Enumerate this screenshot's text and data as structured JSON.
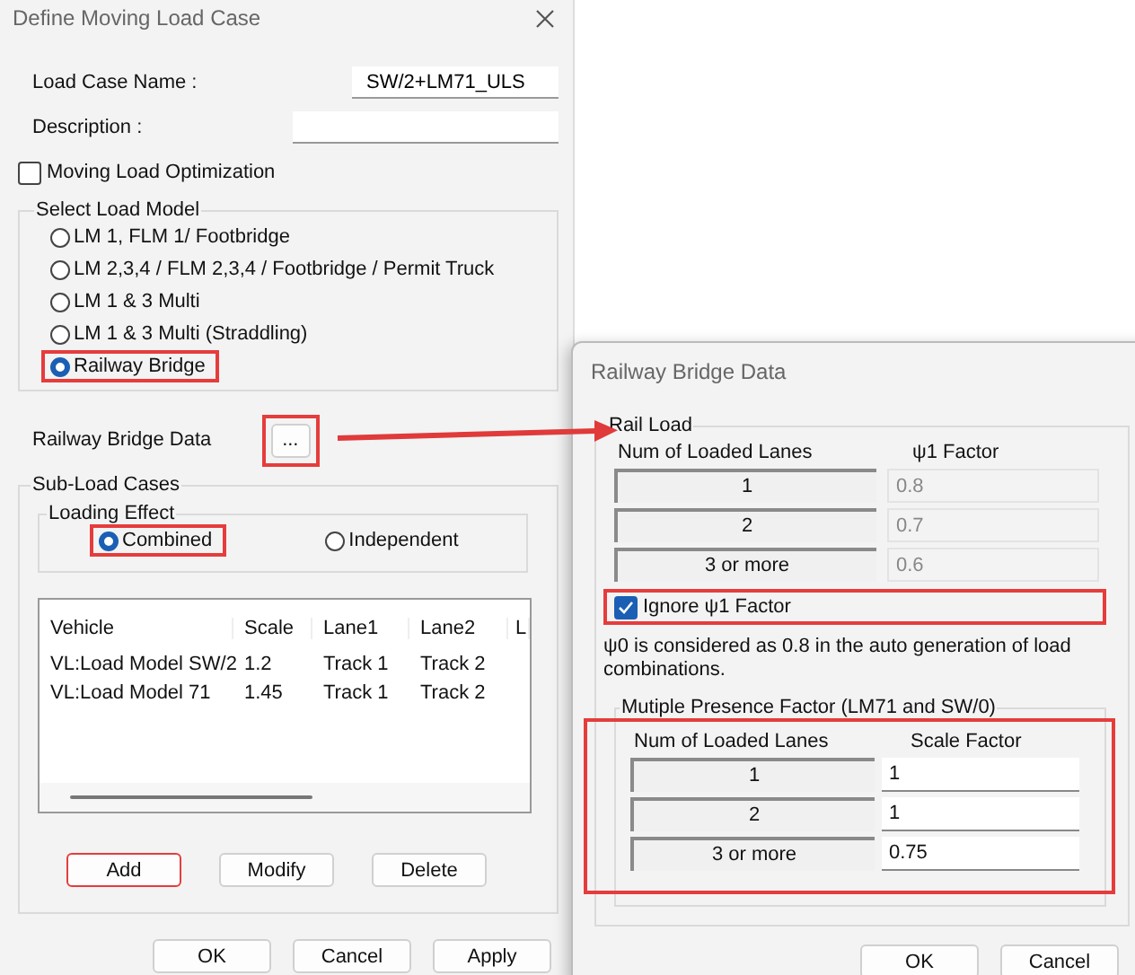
{
  "main_dialog": {
    "title": "Define Moving Load Case",
    "load_case_name": {
      "label": "Load Case Name  :",
      "value": "SW/2+LM71_ULS"
    },
    "description": {
      "label": "Description :"
    },
    "optimization": {
      "label": "Moving Load Optimization",
      "checked": false
    },
    "load_model": {
      "title": "Select Load Model",
      "options": [
        {
          "label": "LM 1, FLM 1/ Footbridge",
          "selected": false,
          "highlighted": false
        },
        {
          "label": "LM 2,3,4 / FLM 2,3,4 / Footbridge / Permit Truck",
          "selected": false,
          "highlighted": false
        },
        {
          "label": "LM 1 & 3 Multi",
          "selected": false,
          "highlighted": false
        },
        {
          "label": "LM 1 & 3 Multi (Straddling)",
          "selected": false,
          "highlighted": false
        },
        {
          "label": "Railway Bridge",
          "selected": true,
          "highlighted": true
        }
      ]
    },
    "railway_bridge_data": {
      "label": "Railway Bridge Data",
      "button": "...",
      "highlighted": true
    },
    "sub_load_cases": {
      "title": "Sub-Load Cases",
      "loading_effect": {
        "title": "Loading Effect",
        "options": [
          {
            "label": "Combined",
            "selected": true,
            "highlighted": true
          },
          {
            "label": "Independent",
            "selected": false,
            "highlighted": false
          }
        ]
      },
      "table": {
        "columns": [
          "Vehicle",
          "Scale",
          "Lane1",
          "Lane2",
          "L"
        ],
        "rows": [
          [
            "VL:Load Model SW/2",
            "1.2",
            "Track 1",
            "Track 2"
          ],
          [
            "VL:Load Model 71",
            "1.45",
            "Track 1",
            "Track 2"
          ]
        ]
      },
      "buttons": [
        {
          "label": "Add",
          "highlighted": true
        },
        {
          "label": "Modify",
          "highlighted": false
        },
        {
          "label": "Delete",
          "highlighted": false
        }
      ]
    },
    "buttons": [
      "OK",
      "Cancel",
      "Apply"
    ]
  },
  "railway_dialog": {
    "title": "Railway Bridge Data",
    "rail_load": {
      "title": "Rail Load",
      "columns": [
        "Num of Loaded Lanes",
        "ψ1 Factor"
      ],
      "rows": [
        {
          "lanes": "1",
          "factor": "0.8",
          "disabled": true
        },
        {
          "lanes": "2",
          "factor": "0.7",
          "disabled": true
        },
        {
          "lanes": "3 or more",
          "factor": "0.6",
          "disabled": true
        }
      ]
    },
    "ignore": {
      "label": "Ignore ψ1 Factor",
      "checked": true,
      "highlighted": true
    },
    "note": "ψ0 is considered as 0.8 in the auto generation of load combinations.",
    "presence": {
      "title": "Mutiple Presence Factor (LM71 and SW/0)",
      "highlighted": true,
      "columns": [
        "Num of Loaded Lanes",
        "Scale Factor"
      ],
      "rows": [
        {
          "lanes": "1",
          "factor": "1",
          "disabled": false
        },
        {
          "lanes": "2",
          "factor": "1",
          "disabled": false
        },
        {
          "lanes": "3 or more",
          "factor": "0.75",
          "disabled": false
        }
      ]
    },
    "buttons": [
      "OK",
      "Cancel"
    ]
  }
}
